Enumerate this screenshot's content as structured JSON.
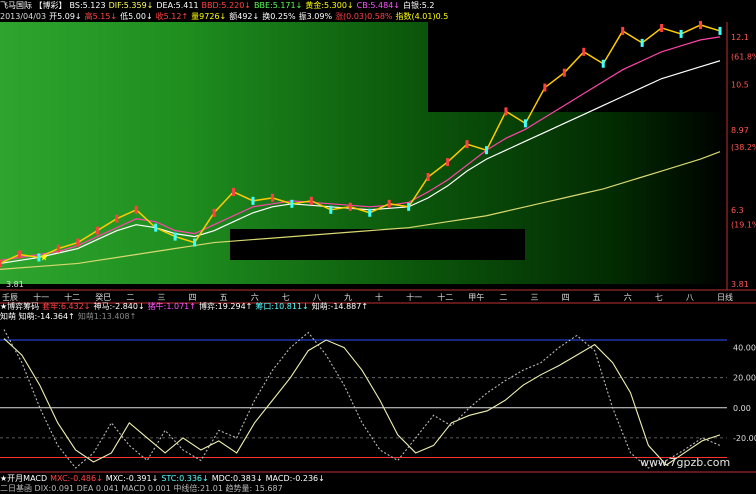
{
  "header": {
    "line1": [
      {
        "t": "飞马国际 【博彩】",
        "c": "#ffffff"
      },
      {
        "t": "BS:5.123",
        "c": "#ffffff"
      },
      {
        "t": "DIF:5.359↓",
        "c": "#ffff55"
      },
      {
        "t": "DEA:5.411",
        "c": "#ffffff"
      },
      {
        "t": "BBD:5.220↓",
        "c": "#ff4444"
      },
      {
        "t": "BBE:5.171↓",
        "c": "#55ff55"
      },
      {
        "t": "黄金:5.300↓",
        "c": "#ffff00"
      },
      {
        "t": "CB:5.484↓",
        "c": "#ff55ff"
      },
      {
        "t": "白银:5.2",
        "c": "#ffffff"
      }
    ],
    "line2": [
      {
        "t": "2013/04/03",
        "c": "#dddddd"
      },
      {
        "t": "开5.09↓",
        "c": "#ffffff"
      },
      {
        "t": "高5.15↓",
        "c": "#ff4444"
      },
      {
        "t": "低5.00↓",
        "c": "#ffffff"
      },
      {
        "t": "收5.12↑",
        "c": "#ff4444"
      },
      {
        "t": "量9726↓",
        "c": "#ffff00"
      },
      {
        "t": "额492↓",
        "c": "#ffffff"
      },
      {
        "t": "换0.25%",
        "c": "#ffffff"
      },
      {
        "t": "振3.09%",
        "c": "#ffffff"
      },
      {
        "t": "涨(0.03)0.58%",
        "c": "#ff4444"
      },
      {
        "t": "指数(4.01)0.5",
        "c": "#ffff00"
      }
    ]
  },
  "price_axis": {
    "labels": [
      {
        "t": "12.1",
        "v": 12.1,
        "c": "#ff5555"
      },
      {
        "t": "(61.8%",
        "v": 11.45,
        "c": "#ff5555"
      },
      {
        "t": "10.5",
        "v": 10.5,
        "c": "#ff5555"
      },
      {
        "t": "8.97",
        "v": 8.97,
        "c": "#ff5555"
      },
      {
        "t": "(38.2%",
        "v": 8.4,
        "c": "#ff5555"
      },
      {
        "t": "6.3",
        "v": 6.3,
        "c": "#ff5555"
      },
      {
        "t": "(19.1%",
        "v": 5.8,
        "c": "#ff5555"
      },
      {
        "t": "3.81",
        "v": 3.81,
        "c": "#ff5555"
      }
    ],
    "low_label": "3.81",
    "star_label": "★"
  },
  "time_axis": {
    "labels": [
      "壬辰",
      "十一",
      "十二",
      "癸巳",
      "二",
      "三",
      "四",
      "五",
      "六",
      "七",
      "八",
      "九",
      "十",
      "十一",
      "十二",
      "甲午",
      "二",
      "三",
      "四",
      "五",
      "六",
      "七",
      "八",
      "日线"
    ]
  },
  "indicator": {
    "title_line": [
      {
        "t": "★博弈筹码",
        "c": "#ffffff"
      },
      {
        "t": "套牢:6.432↓",
        "c": "#ff4444"
      },
      {
        "t": "神马:-2.840↓",
        "c": "#ffffff"
      },
      {
        "t": "猪牛:1.071↑",
        "c": "#ff55ff"
      },
      {
        "t": "博弈:19.294↑",
        "c": "#ffffff"
      },
      {
        "t": "筹口:10.811↓",
        "c": "#55ffff"
      },
      {
        "t": "知萌:-14.887↑",
        "c": "#ffffff"
      }
    ],
    "sub_line": [
      {
        "t": "知萌 知萌:-14.364↑",
        "c": "#ffffff"
      },
      {
        "t": "知萌1:13.408↑",
        "c": "#888888"
      }
    ],
    "axis_labels": [
      {
        "t": "40.00",
        "v": 40
      },
      {
        "t": "20.00",
        "v": 20
      },
      {
        "t": "0.00",
        "v": 0
      },
      {
        "t": "-20.00",
        "v": -20
      }
    ],
    "ylim": [
      -40,
      55
    ]
  },
  "bottom": {
    "line1": [
      {
        "t": "★开月MACD",
        "c": "#ffffff"
      },
      {
        "t": "MXC:-0.486↓",
        "c": "#ff4444"
      },
      {
        "t": "MXC:-0.391↓",
        "c": "#ffffff"
      },
      {
        "t": "STC:0.336↓",
        "c": "#55ffff"
      },
      {
        "t": "MDC:0.383↓",
        "c": "#ffffff"
      },
      {
        "t": "MACD:-0.236↓",
        "c": "#ffffff"
      }
    ],
    "line2_partial": "二日基函 DIX:0.091 DEA 0.041 MACD 0.001 中线倍:21.01 趋势量: 15.687"
  },
  "watermark": "www.7gpzb.com",
  "chart_data": [
    {
      "type": "line",
      "title": "飞马国际 日线",
      "ylim": [
        3.81,
        12.6
      ],
      "x": [
        0,
        4,
        8,
        12,
        16,
        20,
        24,
        28,
        32,
        36,
        40,
        44,
        48,
        52,
        56,
        60,
        64,
        68,
        72,
        76,
        80,
        84,
        88,
        92,
        96,
        100,
        104,
        108,
        112,
        116,
        120,
        124,
        128,
        132,
        136,
        140,
        144,
        148
      ],
      "series": [
        {
          "name": "黄金",
          "values": [
            4.3,
            4.35,
            4.4,
            4.45,
            4.5,
            4.6,
            4.7,
            4.8,
            4.9,
            5.0,
            5.1,
            5.2,
            5.25,
            5.3,
            5.35,
            5.4,
            5.45,
            5.5,
            5.55,
            5.6,
            5.65,
            5.7,
            5.8,
            5.9,
            6.0,
            6.1,
            6.25,
            6.4,
            6.55,
            6.7,
            6.85,
            7.0,
            7.2,
            7.4,
            7.6,
            7.8,
            8.0,
            8.25
          ]
        },
        {
          "name": "白银",
          "values": [
            4.5,
            4.6,
            4.7,
            4.85,
            5.0,
            5.3,
            5.6,
            5.8,
            5.7,
            5.5,
            5.4,
            5.6,
            5.9,
            6.2,
            6.4,
            6.5,
            6.45,
            6.4,
            6.35,
            6.3,
            6.35,
            6.4,
            6.7,
            7.1,
            7.6,
            8.0,
            8.3,
            8.6,
            8.9,
            9.2,
            9.5,
            9.8,
            10.1,
            10.4,
            10.7,
            10.9,
            11.1,
            11.3
          ]
        },
        {
          "name": "CB",
          "values": [
            4.6,
            4.7,
            4.8,
            4.9,
            5.1,
            5.4,
            5.7,
            6.0,
            5.9,
            5.6,
            5.5,
            5.8,
            6.1,
            6.4,
            6.5,
            6.6,
            6.55,
            6.5,
            6.45,
            6.4,
            6.45,
            6.55,
            6.9,
            7.3,
            7.8,
            8.3,
            8.7,
            9.0,
            9.4,
            9.8,
            10.2,
            10.6,
            11.0,
            11.3,
            11.6,
            11.8,
            12.0,
            12.1
          ]
        },
        {
          "name": "收盘",
          "values": [
            4.5,
            4.8,
            4.7,
            5.0,
            5.2,
            5.6,
            6.0,
            6.3,
            5.7,
            5.4,
            5.2,
            6.2,
            6.9,
            6.6,
            6.7,
            6.5,
            6.6,
            6.3,
            6.4,
            6.2,
            6.5,
            6.4,
            7.4,
            7.9,
            8.5,
            8.3,
            9.6,
            9.2,
            10.4,
            10.9,
            11.6,
            11.2,
            12.3,
            11.9,
            12.4,
            12.2,
            12.5,
            12.3
          ]
        }
      ]
    },
    {
      "type": "line",
      "title": "知萌",
      "ylim": [
        -40,
        55
      ],
      "x": [
        0,
        1,
        2,
        3,
        4,
        5,
        6,
        7,
        8,
        9,
        10,
        11,
        12,
        13,
        14,
        15,
        16,
        17,
        18,
        19,
        20,
        21,
        22,
        23,
        24,
        25,
        26,
        27,
        28,
        29,
        30,
        31,
        32,
        33,
        34,
        35,
        36,
        37,
        38,
        39,
        40
      ],
      "series": [
        {
          "name": "知萌",
          "values": [
            46,
            35,
            15,
            -10,
            -28,
            -36,
            -30,
            -10,
            -20,
            -30,
            -20,
            -28,
            -22,
            -30,
            -10,
            5,
            20,
            38,
            45,
            40,
            25,
            5,
            -18,
            -30,
            -25,
            -10,
            -5,
            -2,
            5,
            15,
            22,
            28,
            35,
            42,
            30,
            10,
            -25,
            -38,
            -30,
            -22,
            -18
          ]
        },
        {
          "name": "知萌1",
          "values": [
            52,
            30,
            0,
            -25,
            -40,
            -30,
            -10,
            -25,
            -35,
            -15,
            -28,
            -35,
            -15,
            -20,
            5,
            25,
            40,
            50,
            35,
            15,
            -10,
            -28,
            -35,
            -20,
            -5,
            -12,
            0,
            10,
            18,
            25,
            30,
            40,
            48,
            38,
            0,
            -30,
            -40,
            -35,
            -28,
            -20,
            -25
          ]
        }
      ]
    }
  ]
}
